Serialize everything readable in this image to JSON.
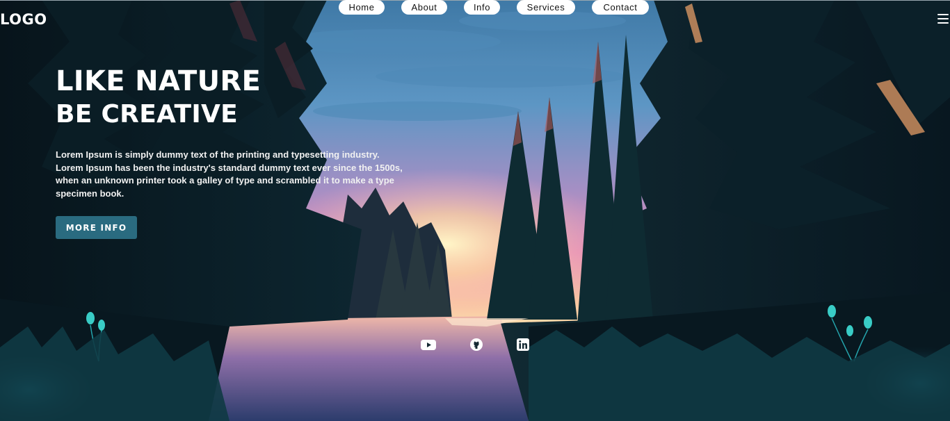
{
  "header": {
    "logo": "LOGO",
    "nav": [
      {
        "label": "Home"
      },
      {
        "label": "About"
      },
      {
        "label": "Info"
      },
      {
        "label": "Services"
      },
      {
        "label": "Contact"
      }
    ],
    "menu_icon": "hamburger-menu-icon"
  },
  "hero": {
    "title_line1": "LIKE NATURE",
    "title_line2": "BE CREATIVE",
    "description_lines": [
      "Lorem Ipsum is simply dummy text of the printing and typesetting industry.",
      "Lorem Ipsum has been the industry's standard dummy text ever since the 1500s,",
      "when an unknown printer took a galley of type and scrambled it to make a type",
      "specimen book."
    ],
    "button_label": "MORE INFO"
  },
  "social": [
    {
      "icon": "youtube-icon"
    },
    {
      "icon": "github-icon"
    },
    {
      "icon": "linkedin-icon"
    }
  ],
  "colors": {
    "button_bg": "#2a6b80",
    "nav_pill_bg": "#ffffff",
    "text": "#ffffff"
  }
}
